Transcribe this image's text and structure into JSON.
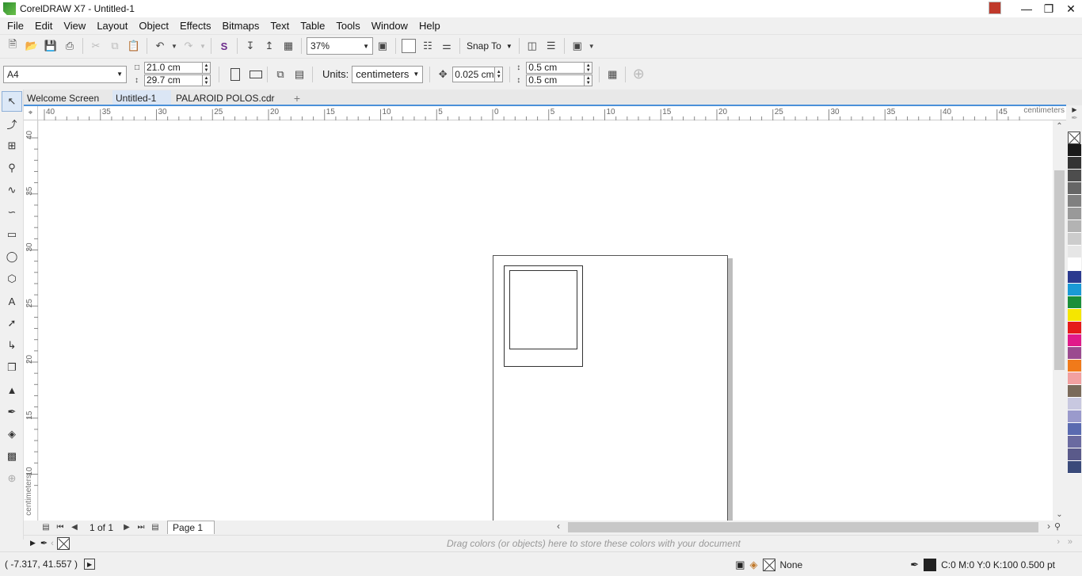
{
  "window": {
    "title": "CorelDRAW X7 - Untitled-1"
  },
  "menu": [
    "File",
    "Edit",
    "View",
    "Layout",
    "Object",
    "Effects",
    "Bitmaps",
    "Text",
    "Table",
    "Tools",
    "Window",
    "Help"
  ],
  "toolbar": {
    "zoom_value": "37%",
    "snap_label": "Snap To"
  },
  "property_bar": {
    "page_size": "A4",
    "width": "21.0 cm",
    "height": "29.7 cm",
    "units_label": "Units:",
    "units_value": "centimeters",
    "nudge": "0.025 cm",
    "dup_x": "0.5 cm",
    "dup_y": "0.5 cm"
  },
  "tabs": [
    {
      "label": "Welcome Screen",
      "active": false
    },
    {
      "label": "Untitled-1",
      "active": true
    },
    {
      "label": "PALAROID POLOS.cdr",
      "active": false
    }
  ],
  "ruler": {
    "unit_label": "centimeters",
    "top_ticks": [
      "40",
      "35",
      "30",
      "25",
      "20",
      "15",
      "10",
      "5",
      "0",
      "5",
      "10",
      "15",
      "20",
      "25",
      "30",
      "35",
      "40",
      "45"
    ],
    "left_ticks": [
      "40",
      "35",
      "30",
      "25",
      "20",
      "15",
      "10"
    ]
  },
  "page_nav": {
    "counter": "1 of 1",
    "page_tab": "Page 1"
  },
  "doc_palette": {
    "hint": "Drag colors (or objects) here to store these colors with your document"
  },
  "status": {
    "coords": "( -7.317, 41.557 )",
    "fill_label": "None",
    "outline_info": "C:0 M:0 Y:0 K:100  0.500 pt"
  },
  "palette_colors": [
    "#1a1a1a",
    "#333333",
    "#4d4d4d",
    "#666666",
    "#808080",
    "#999999",
    "#b3b3b3",
    "#cccccc",
    "#e6e6e6",
    "#ffffff",
    "#2b3a8f",
    "#1a9ad6",
    "#1a8f3a",
    "#f5e600",
    "#e51a1a",
    "#e0198a",
    "#9b4a8f",
    "#f07a1a",
    "#f2a0a0",
    "#7a6a5a",
    "#c8c8e0",
    "#9a9acc",
    "#5a6ab0",
    "#6a6aa0",
    "#5a5a8a",
    "#3a4a7a"
  ]
}
